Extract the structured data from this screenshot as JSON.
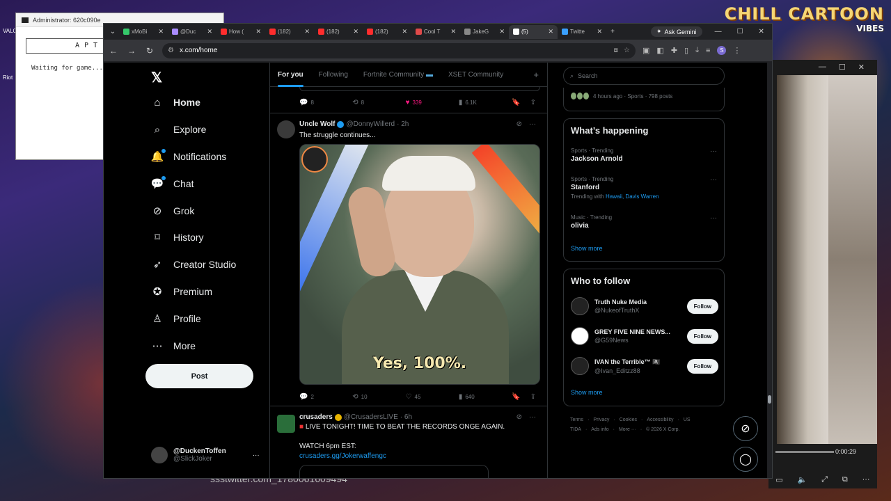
{
  "wallpaper": {
    "brand_line1": "CHILL CARTOON",
    "brand_line2": "VIBES"
  },
  "console": {
    "title": "Administrator: 620c090e",
    "input_text": "APTI",
    "status": "Waiting for game..."
  },
  "desktop_icons": [
    "VALO",
    "Riot"
  ],
  "player": {
    "time": "0:00:29",
    "caption": "ssstwitter.com_1780061609494"
  },
  "browser": {
    "tabs": [
      {
        "label": "xMoBi",
        "color": "#35c96b"
      },
      {
        "label": "@Duc",
        "color": "#a98bff"
      },
      {
        "label": "How (",
        "color": "#ff2d2d"
      },
      {
        "label": "(182)",
        "color": "#ff2d2d"
      },
      {
        "label": "(182)",
        "color": "#ff2d2d"
      },
      {
        "label": "(182)",
        "color": "#ff2d2d"
      },
      {
        "label": "Cool T",
        "color": "#e04a4a"
      },
      {
        "label": "JakeG",
        "color": "#888888"
      },
      {
        "label": "(5)",
        "color": "#ffffff"
      },
      {
        "label": "Twitte",
        "color": "#3aa0ff"
      }
    ],
    "gemini_label": "Ask Gemini",
    "url": "x.com/home"
  },
  "nav": {
    "items": [
      {
        "label": "Home",
        "icon": "home-icon"
      },
      {
        "label": "Explore",
        "icon": "search-icon"
      },
      {
        "label": "Notifications",
        "icon": "bell-icon"
      },
      {
        "label": "Chat",
        "icon": "chat-icon"
      },
      {
        "label": "Grok",
        "icon": "grok-icon"
      },
      {
        "label": "History",
        "icon": "bookmark-icon"
      },
      {
        "label": "Creator Studio",
        "icon": "rocket-icon"
      },
      {
        "label": "Premium",
        "icon": "verified-icon"
      },
      {
        "label": "Profile",
        "icon": "person-icon"
      },
      {
        "label": "More",
        "icon": "more-circle-icon"
      }
    ],
    "post_label": "Post",
    "account": {
      "name": "@DuckenToffen",
      "handle": "@SlickJoker"
    }
  },
  "feed": {
    "tabs": [
      "For you",
      "Following",
      "Fortnite Community",
      "XSET Community"
    ],
    "prev_actions": {
      "replies": "8",
      "reposts": "8",
      "likes": "339",
      "views": "6.1K"
    },
    "tweet1": {
      "name": "Uncle Wolf",
      "handle": "@DonnyWillerd",
      "time": "· 2h",
      "text": "The struggle continues...",
      "caption": "Yes, 100%.",
      "actions": {
        "replies": "2",
        "reposts": "10",
        "likes": "45",
        "views": "640"
      }
    },
    "tweet2": {
      "name": "crusaders",
      "handle": "@CrusadersLIVE",
      "time": "· 6h",
      "line1": "LIVE TONIGHT! TIME TO BEAT THE RECORDS ONGE AGAIN.",
      "line2": "WATCH 6pm EST:",
      "link": "crusaders.gg/Jokerwaffengc"
    }
  },
  "right": {
    "search_placeholder": "Search",
    "top_card_meta": "4 hours ago · Sports · 798 posts",
    "happening_title": "What’s happening",
    "trends": [
      {
        "meta": "Sports · Trending",
        "name": "Jackson Arnold"
      },
      {
        "meta": "Sports · Trending",
        "name": "Stanford",
        "with": "Trending with",
        "with_links": "Hawaii, Davis Warren"
      },
      {
        "meta": "Music · Trending",
        "name": "olivia"
      }
    ],
    "show_more": "Show more",
    "wtf_title": "Who to follow",
    "follow_label": "Follow",
    "suggestions": [
      {
        "name": "Truth Nuke Media",
        "handle": "@NukeofTruthX"
      },
      {
        "name": "GREY FIVE NINE NEWS...",
        "handle": "@G59News"
      },
      {
        "name": "IVAN the Terrible™ 🏴‍☠️",
        "handle": "@Ivan_Editzz88"
      }
    ],
    "footer": [
      "Terms",
      "·",
      "Privacy",
      "·",
      "Cookies",
      "·",
      "Accessibility",
      "·",
      "US TIDA",
      "·",
      "Ads info",
      "·",
      "More ···",
      "·",
      "© 2026 X Corp."
    ]
  }
}
